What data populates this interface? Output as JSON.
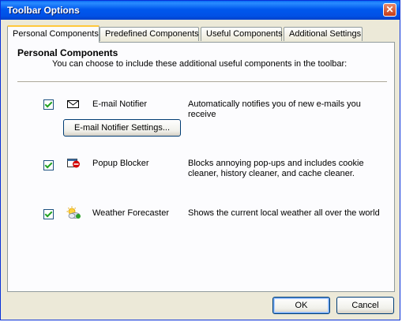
{
  "window": {
    "title": "Toolbar Options",
    "close_glyph": "✕"
  },
  "tabs": [
    {
      "label": "Personal Components",
      "active": true
    },
    {
      "label": "Predefined Components",
      "active": false
    },
    {
      "label": "Useful Components",
      "active": false
    },
    {
      "label": "Additional Settings",
      "active": false
    }
  ],
  "panel": {
    "title": "Personal Components",
    "description": "You can choose to include these additional useful components in the toolbar:"
  },
  "components": [
    {
      "name": "E-mail Notifier",
      "checked": true,
      "icon": "envelope-icon",
      "description": "Automatically notifies you of new e-mails you receive",
      "settings_button": "E-mail Notifier Settings..."
    },
    {
      "name": "Popup Blocker",
      "checked": true,
      "icon": "popup-blocker-icon",
      "description": "Blocks annoying pop-ups and includes cookie cleaner, history cleaner, and cache cleaner."
    },
    {
      "name": "Weather Forecaster",
      "checked": true,
      "icon": "weather-icon",
      "description": "Shows the current local weather all over the world"
    }
  ],
  "buttons": {
    "ok": "OK",
    "cancel": "Cancel"
  },
  "colors": {
    "titlebar": "#0058ee",
    "tab_highlight": "#ffc83c",
    "dialog_bg": "#ece9d8"
  }
}
